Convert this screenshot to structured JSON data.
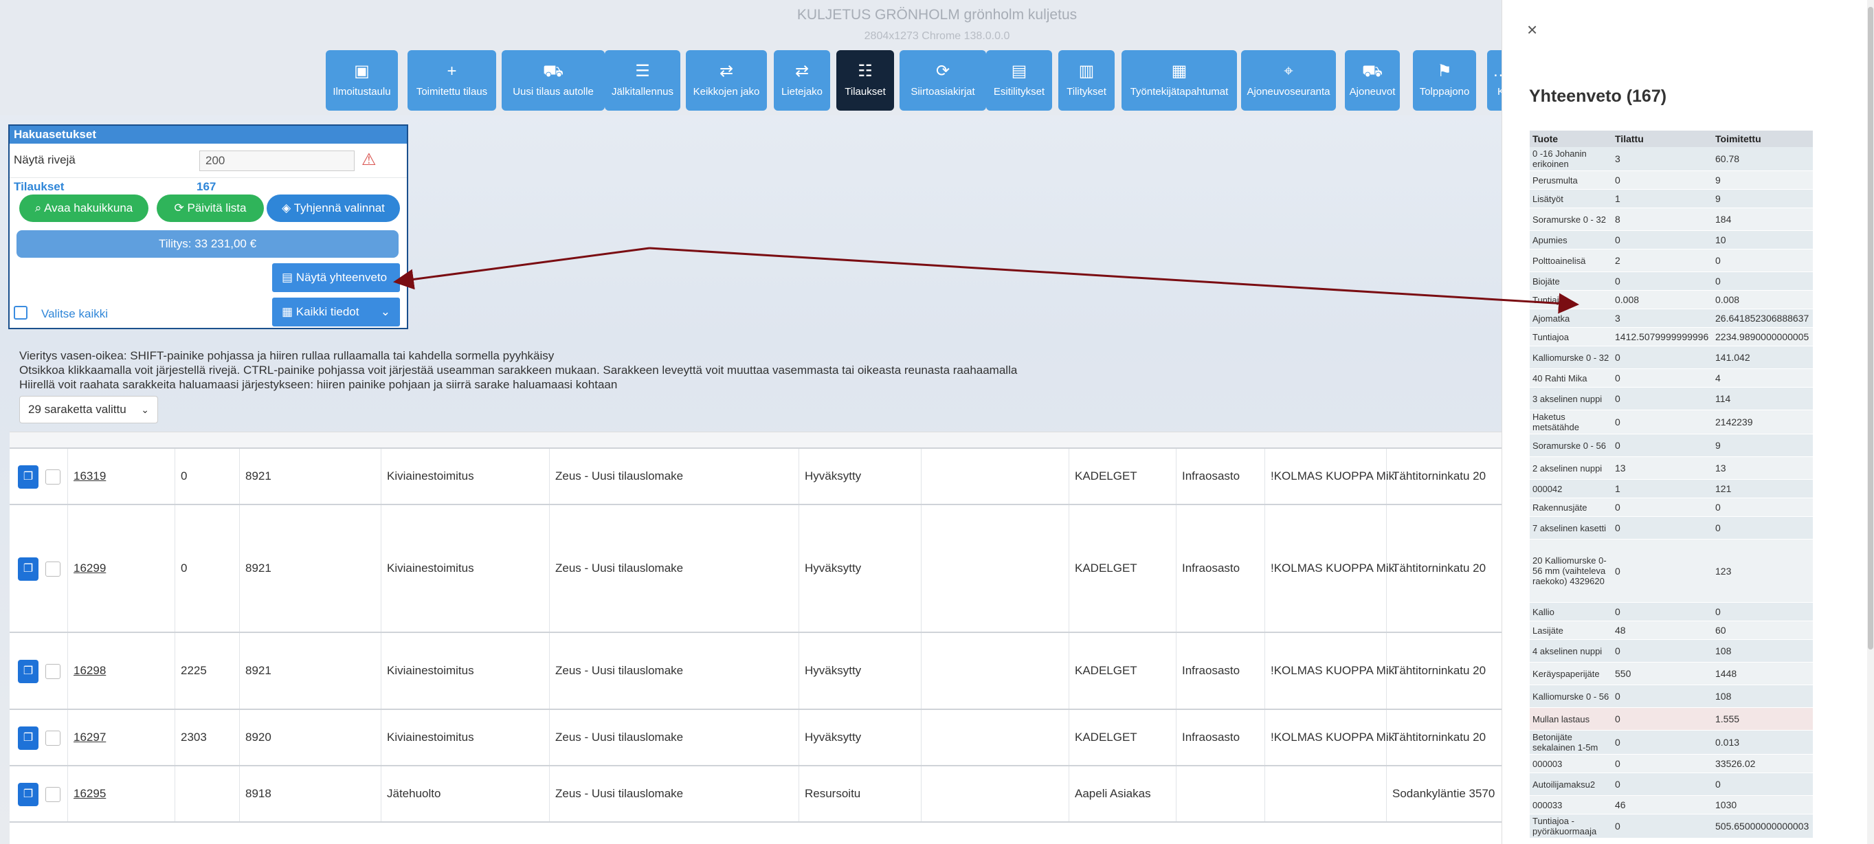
{
  "app": {
    "title": "KULJETUS GRÖNHOLM grönholm kuljetus",
    "subtitle": "2804x1273 Chrome 138.0.0.0"
  },
  "nav": [
    {
      "label": "Ilmoitustaulu",
      "icon": "dashboard-icon"
    },
    {
      "label": "Toimitettu tilaus",
      "icon": "plus-icon"
    },
    {
      "label": "Uusi tilaus autolle",
      "icon": "truck-plus-icon"
    },
    {
      "label": "Jälkitallennus",
      "icon": "list-icon"
    },
    {
      "label": "Keikkojen jako",
      "icon": "repeat-icon"
    },
    {
      "label": "Lietejako",
      "icon": "repeat-icon"
    },
    {
      "label": "Tilaukset",
      "icon": "ordered-list-icon"
    },
    {
      "label": "Siirtoasiakirjat",
      "icon": "document-sync-icon"
    },
    {
      "label": "Esitilitykset",
      "icon": "invoice-icon"
    },
    {
      "label": "Tilitykset",
      "icon": "document-icon"
    },
    {
      "label": "Työntekijätapahtumat",
      "icon": "clipboard-icon"
    },
    {
      "label": "Ajoneuvoseuranta",
      "icon": "crosshair-icon"
    },
    {
      "label": "Ajoneuvot",
      "icon": "truck-icon"
    },
    {
      "label": "Tolppajono",
      "icon": "flag-icon"
    },
    {
      "label": "K",
      "icon": "more-icon"
    }
  ],
  "search": {
    "title": "Hakuasetukset",
    "rows_label": "Näytä rivejä",
    "rows_value": "200",
    "orders_label": "Tilaukset",
    "orders_count": "167",
    "open_search": "Avaa hakuikkuna",
    "refresh": "Päivitä lista",
    "clear": "Tyhjennä valinnat",
    "tilitys": "Tilitys: 33 231,00 €",
    "summary_btn": "Näytä yhteenveto",
    "select_all": "Valitse kaikki",
    "all_info": "Kaikki tiedot"
  },
  "help": {
    "line1": "Vieritys vasen-oikea: SHIFT-painike pohjassa ja hiiren rullaa rullaamalla tai kahdella sormella pyyhkäisy",
    "line2": "Otsikkoa klikkaamalla voit järjestellä rivejä. CTRL-painike pohjassa voit järjestää useamman sarakkeen mukaan. Sarakkeen leveyttä voit muuttaa vasemmasta tai oikeasta reunasta raahaamalla",
    "line3": "Hiirellä voit raahata sarakkeita haluamaasi järjestykseen: hiiren painike pohjaan ja siirrä sarake haluamaasi kohtaan",
    "columns_selected": "29 saraketta valittu"
  },
  "orders": [
    {
      "id": "16319",
      "c2": "0",
      "c3": "8921",
      "type": "Kiviainestoimitus",
      "form": "Zeus - Uusi tilauslomake",
      "status": "Hyväksytty",
      "c7": "",
      "customer": "KADELGET",
      "dept": "Infraosasto",
      "site": "!KOLMAS KUOPPA Mika",
      "address": "Tähtitorninkatu 20"
    },
    {
      "id": "16299",
      "c2": "0",
      "c3": "8921",
      "type": "Kiviainestoimitus",
      "form": "Zeus - Uusi tilauslomake",
      "status": "Hyväksytty",
      "c7": "",
      "customer": "KADELGET",
      "dept": "Infraosasto",
      "site": "!KOLMAS KUOPPA Mika",
      "address": "Tähtitorninkatu 20"
    },
    {
      "id": "16298",
      "c2": "2225",
      "c3": "8921",
      "type": "Kiviainestoimitus",
      "form": "Zeus - Uusi tilauslomake",
      "status": "Hyväksytty",
      "c7": "",
      "customer": "KADELGET",
      "dept": "Infraosasto",
      "site": "!KOLMAS KUOPPA Mika",
      "address": "Tähtitorninkatu 20"
    },
    {
      "id": "16297",
      "c2": "2303",
      "c3": "8920",
      "type": "Kiviainestoimitus",
      "form": "Zeus - Uusi tilauslomake",
      "status": "Hyväksytty",
      "c7": "",
      "customer": "KADELGET",
      "dept": "Infraosasto",
      "site": "!KOLMAS KUOPPA Mika",
      "address": "Tähtitorninkatu 20"
    },
    {
      "id": "16295",
      "c2": "",
      "c3": "8918",
      "type": "Jätehuolto",
      "form": "Zeus - Uusi tilauslomake",
      "status": "Resursoitu",
      "c7": "",
      "customer": "Aapeli Asiakas",
      "dept": "",
      "site": "",
      "address": "Sodankyläntie 3570"
    }
  ],
  "summary": {
    "title": "Yhteenveto (167)",
    "headers": [
      "Tuote",
      "Tilattu",
      "Toimitettu"
    ],
    "rows": [
      [
        "0 -16 Johanin erikoinen",
        "3",
        "60.78"
      ],
      [
        "Perusmulta",
        "0",
        "9"
      ],
      [
        "Lisätyöt",
        "1",
        "9"
      ],
      [
        "Soramurske 0 - 32",
        "8",
        "184"
      ],
      [
        "Apumies",
        "0",
        "10"
      ],
      [
        "Polttoainelisä",
        "2",
        "0"
      ],
      [
        "Biojäte",
        "0",
        "0"
      ],
      [
        "Tuntiajo",
        "0.008",
        "0.008"
      ],
      [
        "Ajomatka",
        "3",
        "26.641852306888637"
      ],
      [
        "Tuntiajoa",
        "1412.5079999999996",
        "2234.9890000000005"
      ],
      [
        "Kalliomurske 0 - 32",
        "0",
        "141.042"
      ],
      [
        "40 Rahti Mika",
        "0",
        "4"
      ],
      [
        "3 akselinen nuppi",
        "0",
        "114"
      ],
      [
        "Haketus metsätähde",
        "0",
        "2142239"
      ],
      [
        "Soramurske 0 - 56",
        "0",
        "9"
      ],
      [
        "2 akselinen nuppi",
        "13",
        "13"
      ],
      [
        "000042",
        "1",
        "121"
      ],
      [
        "Rakennusjäte",
        "0",
        "0"
      ],
      [
        "7 akselinen kasetti",
        "0",
        "0"
      ],
      [
        "20 Kalliomurske 0-56 mm (vaihteleva raekoko) 4329620",
        "0",
        "123"
      ],
      [
        "Kallio",
        "0",
        "0"
      ],
      [
        "Lasijäte",
        "48",
        "60"
      ],
      [
        "4 akselinen nuppi",
        "0",
        "108"
      ],
      [
        "Keräyspaperijäte",
        "550",
        "1448"
      ],
      [
        "Kalliomurske 0 - 56",
        "0",
        "108"
      ],
      [
        "Mullan lastaus",
        "0",
        "1.555"
      ],
      [
        "Betonijäte sekalainen 1-5m",
        "0",
        "0.013"
      ],
      [
        "000003",
        "0",
        "33526.02"
      ],
      [
        "Autoilijamaksu2",
        "0",
        "0"
      ],
      [
        "000033",
        "46",
        "1030"
      ],
      [
        "Tuntiajoa - pyöräkuormaaja",
        "0",
        "505.65000000000003"
      ]
    ]
  },
  "colors": {
    "primary": "#4a9be0",
    "active": "#14253a",
    "green": "#2fb45a",
    "arrow": "#7a0d12"
  }
}
